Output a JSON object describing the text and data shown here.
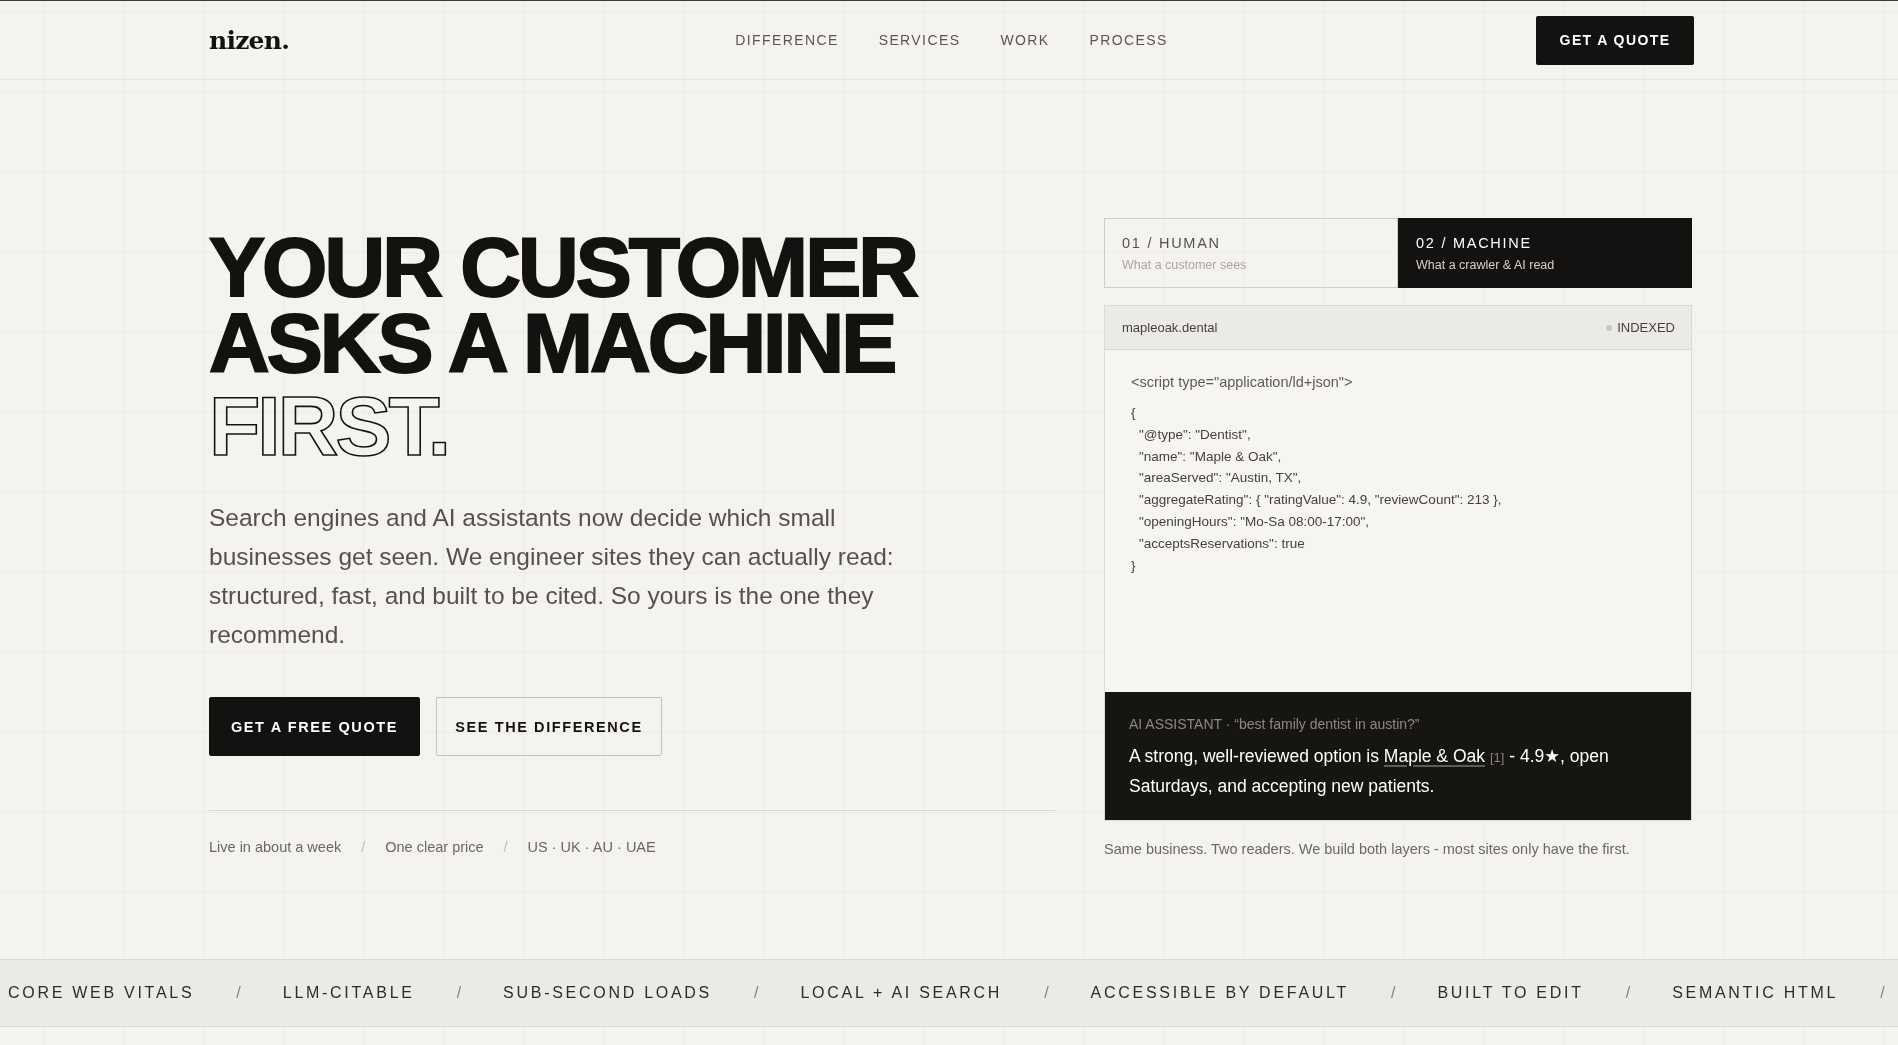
{
  "header": {
    "logo": "nizen.",
    "nav": [
      "DIFFERENCE",
      "SERVICES",
      "WORK",
      "PROCESS"
    ],
    "cta": "GET A QUOTE"
  },
  "hero": {
    "headline": [
      {
        "text": "YOUR CUSTOMER",
        "kind": "solid"
      },
      {
        "text": "ASKS A MACHINE",
        "kind": "solid"
      },
      {
        "text": "FIRST.",
        "kind": "outline"
      }
    ],
    "description": "Search engines and AI assistants now decide which small businesses get seen. We engineer sites they can actually read: structured, fast, and built to be cited. So yours is the one they recommend.",
    "buttons": [
      {
        "label": "GET A FREE QUOTE",
        "kind": "primary"
      },
      {
        "label": "SEE THE DIFFERENCE",
        "kind": "secondary"
      }
    ],
    "facts": [
      {
        "text": "Live in about a week",
        "separator": "/"
      },
      {
        "text": "One clear price",
        "separator": "/"
      },
      {
        "text": "US · UK · AU · UAE"
      }
    ]
  },
  "preview": {
    "tabs": [
      {
        "label": "01 / HUMAN",
        "caption": "What a customer sees",
        "selected": false
      },
      {
        "label": "02 / MACHINE",
        "caption": "What a crawler & AI read",
        "selected": true
      }
    ],
    "address_bar": {
      "url": "mapleoak.dental",
      "status": "INDEXED"
    },
    "code": {
      "opening_tag": "<script type=\"application/ld+json\">",
      "lines": [
        {
          "text": "{",
          "children": [
            {
              "text": "\"@type\": \"Dentist\","
            },
            {
              "text": "\"name\": \"Maple & Oak\","
            },
            {
              "text": "\"areaServed\": \"Austin, TX\","
            },
            {
              "text": "\"aggregateRating\": { \"ratingValue\": 4.9, \"reviewCount\": 213 },"
            },
            {
              "text": "\"openingHours\": \"Mo-Sa 08:00-17:00\","
            },
            {
              "text": "\"acceptsReservations\": true"
            }
          ]
        },
        {
          "text": "}"
        }
      ]
    },
    "assistant": {
      "query": "AI ASSISTANT · “best family dentist in austin?”",
      "answer": {
        "before": "A strong, well-reviewed option is ",
        "link": "Maple & Oak",
        "citation": "[1]",
        "after": " - 4.9★, open Saturdays, and accepting new patients."
      }
    },
    "caption": "Same business. Two readers. We build both layers - most sites only have the first."
  },
  "marquee": [
    {
      "label": "CORE WEB VITALS",
      "separator": "/"
    },
    {
      "label": "LLM-CITABLE",
      "separator": "/"
    },
    {
      "label": "SUB-SECOND LOADS",
      "separator": "/"
    },
    {
      "label": "LOCAL + AI SEARCH",
      "separator": "/"
    },
    {
      "label": "ACCESSIBLE BY DEFAULT",
      "separator": "/"
    },
    {
      "label": "BUILT TO EDIT",
      "separator": "/"
    },
    {
      "label": "SEMANTIC HTML",
      "separator": "/"
    }
  ]
}
